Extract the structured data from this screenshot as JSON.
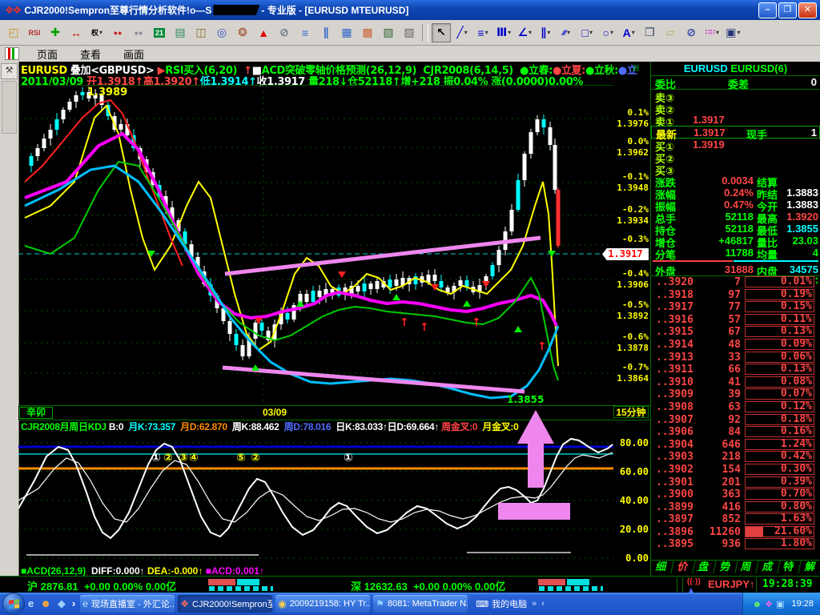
{
  "title_bar": {
    "title_left": "CJR2000!Sempron至尊行情分析软件!o—S",
    "title_right": " - 专业版 - [EURUSD MTEURUSD]",
    "minimize": "–",
    "maximize": "❐",
    "close": "✕"
  },
  "menu": {
    "items": [
      "页面",
      "查看",
      "画面"
    ]
  },
  "toolbar": {
    "left": [
      {
        "name": "open-chart-icon",
        "glyph": "◰",
        "color": "#c8901c"
      },
      {
        "name": "rsi-icon",
        "glyph": "RSI",
        "color": "#b03030",
        "small": true
      },
      {
        "name": "move-icon",
        "glyph": "✚",
        "color": "#00a000"
      },
      {
        "name": "swap-icon",
        "glyph": "↔",
        "color": "#cc0000"
      },
      {
        "name": "rights-restore-icon",
        "glyph": "权",
        "color": "#000000",
        "small": true,
        "dd": true
      },
      {
        "name": "signal-lights-icon",
        "glyph": "●●",
        "color": "#cc2222",
        "small": true
      },
      {
        "name": "signal-lights-off-icon",
        "glyph": "●●",
        "color": "#888899",
        "small": true
      },
      {
        "name": "calendar-icon",
        "glyph": "21",
        "color": "#ffffff",
        "bg": "#0a8a3a",
        "small": true
      },
      {
        "name": "books-icon",
        "glyph": "▤",
        "color": "#2e8b57"
      },
      {
        "name": "open-book-icon",
        "glyph": "◫",
        "color": "#8a6a2a"
      },
      {
        "name": "magnifier-icon",
        "glyph": "◎",
        "color": "#2a52be"
      },
      {
        "name": "palette-icon",
        "glyph": "❂",
        "color": "#a0522d"
      },
      {
        "name": "alarm-bell-icon",
        "glyph": "▲",
        "color": "#dd0000"
      },
      {
        "name": "mouse-icon",
        "glyph": "⊘",
        "color": "#667788"
      },
      {
        "name": "tile-rows-icon",
        "glyph": "≡",
        "color": "#3366cc"
      },
      {
        "name": "tile-columns-icon",
        "glyph": "∥",
        "color": "#3366cc"
      },
      {
        "name": "chart-window-icon-1",
        "glyph": "▦",
        "color": "#3366cc"
      },
      {
        "name": "chart-window-icon-2",
        "glyph": "▩",
        "color": "#cc6633"
      },
      {
        "name": "chart-window-icon-3",
        "glyph": "▨",
        "color": "#336633"
      },
      {
        "name": "chart-window-icon-4",
        "glyph": "▧",
        "color": "#666666"
      }
    ],
    "right": [
      {
        "name": "pointer-tool-icon",
        "glyph": "↖",
        "color": "#000000",
        "pressed": true
      },
      {
        "name": "line-tool-icon",
        "glyph": "╱",
        "color": "#0000cc",
        "dd": true
      },
      {
        "name": "trendline-tool-icon",
        "glyph": "≡",
        "color": "#0000cc",
        "dd": true
      },
      {
        "name": "vertline-tool-icon",
        "glyph": "Ⅲ",
        "color": "#0000cc",
        "dd": true
      },
      {
        "name": "fan-tool-icon",
        "glyph": "∠",
        "color": "#0000cc",
        "dd": true
      },
      {
        "name": "channel-tool-icon",
        "glyph": "∥",
        "color": "#0000cc",
        "dd": true
      },
      {
        "name": "hatch-tool-icon",
        "glyph": "⁄⁄⁄",
        "color": "#0000cc",
        "dd": true,
        "small": true
      },
      {
        "name": "rect-tool-icon",
        "glyph": "□",
        "color": "#0000cc",
        "dd": true
      },
      {
        "name": "circle-tool-icon",
        "glyph": "○",
        "color": "#0000cc",
        "dd": true
      },
      {
        "name": "text-tool-icon",
        "glyph": "A",
        "color": "#0000cc",
        "dd": true
      },
      {
        "name": "copy-icon",
        "glyph": "❐",
        "color": "#334466"
      },
      {
        "name": "eraser-icon",
        "glyph": "▱",
        "color": "#b8a060"
      },
      {
        "name": "lock-icon",
        "glyph": "⊘",
        "color": "#3344aa"
      },
      {
        "name": "colors-icon",
        "glyph": "∷∷",
        "color": "#cc33cc",
        "small": true,
        "dd": true
      },
      {
        "name": "save-icon",
        "glyph": "▣",
        "color": "#223377",
        "dd": true
      }
    ]
  },
  "info_line1": [
    {
      "t": "EURUSD ",
      "c": "y"
    },
    {
      "t": "叠加<GBPUSD> ",
      "c": "w"
    },
    {
      "t": "▶",
      "c": "r"
    },
    {
      "t": "RSI买入(6,20)  ",
      "c": "g"
    },
    {
      "t": "↑",
      "c": "r"
    },
    {
      "t": "■",
      "c": "w"
    },
    {
      "t": "ACD突破零轴价格预测(26,12,9)  ",
      "c": "g"
    },
    {
      "t": "CJR2008(6,14,5)  ",
      "c": "g"
    },
    {
      "t": "●",
      "c": "g"
    },
    {
      "t": "立春:",
      "c": "g"
    },
    {
      "t": "●",
      "c": "r"
    },
    {
      "t": "立夏:",
      "c": "r"
    },
    {
      "t": "●",
      "c": "g"
    },
    {
      "t": "立秋:",
      "c": "g"
    },
    {
      "t": "●",
      "c": "b"
    },
    {
      "t": "立",
      "c": "b"
    }
  ],
  "info_line2": [
    {
      "t": "2011/03/09 ",
      "c": "g"
    },
    {
      "t": "开1.3918↑",
      "c": "r"
    },
    {
      "t": "高1.3920↑",
      "c": "r"
    },
    {
      "t": "低1.3914↑",
      "c": "c"
    },
    {
      "t": "收1.3917 ",
      "c": "w"
    },
    {
      "t": "量218↓",
      "c": "g"
    },
    {
      "t": "仓52118↑",
      "c": "g"
    },
    {
      "t": "增+218 ",
      "c": "g"
    },
    {
      "t": "振0.04% ",
      "c": "g"
    },
    {
      "t": "涨(0.0000)0.00%",
      "c": "g"
    }
  ],
  "chart": {
    "axis": [
      {
        "pct": "0.1%",
        "price": "1.3976"
      },
      {
        "pct": "0.0%",
        "price": "1.3962"
      },
      {
        "pct": "-0.1%",
        "price": "1.3948"
      },
      {
        "pct": "-0.2%",
        "price": "1.3934"
      },
      {
        "pct": "-0.3%",
        "price": ""
      },
      {
        "pct": "-0.4%",
        "price": "1.3906"
      },
      {
        "pct": "-0.5%",
        "price": "1.3892"
      },
      {
        "pct": "-0.6%",
        "price": "1.3878"
      },
      {
        "pct": "-0.7%",
        "price": "1.3864"
      }
    ],
    "current_price_tag": "1.3917",
    "peak_label": "1.3989",
    "low_label": "1.3855",
    "ganzhi_label": "辛卯",
    "date_label": "03/09",
    "period_label": "15分钟"
  },
  "kdj": {
    "header": [
      {
        "t": "CJR2008月周日KDJ ",
        "c": "g"
      },
      {
        "t": "B:0  ",
        "c": "w"
      },
      {
        "t": "月K:73.357  ",
        "c": "c"
      },
      {
        "t": "月D:62.870  ",
        "c": "o"
      },
      {
        "t": "周K:88.462  ",
        "c": "w"
      },
      {
        "t": "周D:78.016  ",
        "c": "b"
      },
      {
        "t": "日K:83.033↑",
        "c": "w"
      },
      {
        "t": "日D:69.664↑ ",
        "c": "w"
      },
      {
        "t": "周金叉:0  ",
        "c": "r"
      },
      {
        "t": "月金叉:0",
        "c": "y"
      }
    ],
    "axis": [
      "80.00",
      "60.00",
      "40.00",
      "20.00",
      "0.00"
    ],
    "circles": [
      {
        "g": "①",
        "c": "w"
      },
      {
        "g": "②",
        "c": "y"
      },
      {
        "g": "③",
        "c": "y"
      },
      {
        "g": "④",
        "c": "y"
      },
      {
        "g": "⑤",
        "c": "y"
      },
      {
        "g": "②",
        "c": "y"
      },
      {
        "g": "①",
        "c": "w"
      }
    ]
  },
  "acd_line": [
    {
      "t": "■",
      "c": "g"
    },
    {
      "t": "ACD(26,12,9)  ",
      "c": "g"
    },
    {
      "t": "DIFF:0.000↑ ",
      "c": "w"
    },
    {
      "t": "DEA:-0.000↑ ",
      "c": "y"
    },
    {
      "t": "■",
      "c": "m"
    },
    {
      "t": "ACD:0.001↑",
      "c": "m"
    }
  ],
  "right_panel": {
    "symbol": "EURUSD",
    "symbol2": "EURUSD(6)",
    "weibi_label": "委比",
    "weicha_label": "委差",
    "weicha_value": "0",
    "quote_rows": [
      {
        "label": "卖③",
        "value": ""
      },
      {
        "label": "卖②",
        "value": ""
      },
      {
        "label": "卖①",
        "value": "1.3917"
      },
      {
        "label": "最新",
        "value": "1.3917",
        "label2": "现手",
        "value2": "1",
        "latest": true
      },
      {
        "label": "买①",
        "value": "1.3919"
      },
      {
        "label": "买②",
        "value": ""
      },
      {
        "label": "买③",
        "value": ""
      }
    ],
    "stat_rows": [
      {
        "l": "涨跌",
        "v": "0.0034",
        "vc": "r",
        "l2": "结算",
        "v2": "",
        "v2c": "w"
      },
      {
        "l": "涨幅",
        "v": "0.24%",
        "vc": "r",
        "l2": "昨结",
        "v2": "1.3883",
        "v2c": "w"
      },
      {
        "l": "振幅",
        "v": "0.47%",
        "vc": "r",
        "l2": "今开",
        "v2": "1.3883",
        "v2c": "w"
      },
      {
        "l": "总手",
        "v": "52118",
        "vc": "g",
        "l2": "最高",
        "v2": "1.3920",
        "v2c": "r"
      },
      {
        "l": "持仓",
        "v": "52118",
        "vc": "g",
        "l2": "最低",
        "v2": "1.3855",
        "v2c": "c"
      },
      {
        "l": "增仓",
        "v": "+46817",
        "vc": "g",
        "l2": "量比",
        "v2": "23.03",
        "v2c": "g"
      },
      {
        "l": "分笔",
        "v": "11788",
        "vc": "g",
        "l2": "均量",
        "v2": "4",
        "v2c": "g"
      },
      {
        "l": "外盘",
        "v": "31888",
        "vc": "r",
        "l2": "内盘",
        "v2": "34575",
        "v2c": "c"
      }
    ],
    "ladder": [
      {
        "p": "..3920",
        "v": "7",
        "pct": "0.01%"
      },
      {
        "p": "..3918",
        "v": "97",
        "pct": "0.19%"
      },
      {
        "p": "..3917",
        "v": "77",
        "pct": "0.15%"
      },
      {
        "p": "..3916",
        "v": "57",
        "pct": "0.11%"
      },
      {
        "p": "..3915",
        "v": "67",
        "pct": "0.13%"
      },
      {
        "p": "..3914",
        "v": "48",
        "pct": "0.09%"
      },
      {
        "p": "..3913",
        "v": "33",
        "pct": "0.06%"
      },
      {
        "p": "..3911",
        "v": "66",
        "pct": "0.13%"
      },
      {
        "p": "..3910",
        "v": "41",
        "pct": "0.08%"
      },
      {
        "p": "..3909",
        "v": "39",
        "pct": "0.07%"
      },
      {
        "p": "..3908",
        "v": "63",
        "pct": "0.12%"
      },
      {
        "p": "..3907",
        "v": "92",
        "pct": "0.18%"
      },
      {
        "p": "..3906",
        "v": "84",
        "pct": "0.16%"
      },
      {
        "p": "..3904",
        "v": "646",
        "pct": "1.24%"
      },
      {
        "p": "..3903",
        "v": "218",
        "pct": "0.42%"
      },
      {
        "p": "..3902",
        "v": "154",
        "pct": "0.30%"
      },
      {
        "p": "..3901",
        "v": "201",
        "pct": "0.39%"
      },
      {
        "p": "..3900",
        "v": "363",
        "pct": "0.70%"
      },
      {
        "p": "..3899",
        "v": "416",
        "pct": "0.80%"
      },
      {
        "p": "..3897",
        "v": "852",
        "pct": "1.63%"
      },
      {
        "p": "..3896",
        "v": "11260",
        "pct": "21.60%",
        "fill": 22
      },
      {
        "p": "..3895",
        "v": "936",
        "pct": "1.80%"
      }
    ],
    "tabs": [
      "细",
      "价",
      "盘",
      "势",
      "周",
      "成",
      "特",
      "解"
    ],
    "active_tab_index": 1
  },
  "bottom_strip": {
    "hu": [
      {
        "t": "沪 ",
        "c": "g"
      },
      {
        "t": "2876.81  ",
        "c": "g"
      },
      {
        "t": "+0.00 0.00% 0.00亿",
        "c": "g"
      }
    ],
    "shen": [
      {
        "t": "深 ",
        "c": "g"
      },
      {
        "t": "12632.63  ",
        "c": "g"
      },
      {
        "t": "+0.00 0.00% 0.00亿",
        "c": "g"
      }
    ],
    "pair_label": "EURJPY↑",
    "time": "19:28:39"
  },
  "taskbar": {
    "quick_launch": [
      {
        "name": "ie-quicklaunch-icon",
        "glyph": "e",
        "color": "#bfe0ff"
      },
      {
        "name": "qq-quicklaunch-icon",
        "glyph": "☻",
        "color": "#ffaa33"
      },
      {
        "name": "msn-quicklaunch-icon",
        "glyph": "◆",
        "color": "#9fd0ff"
      },
      {
        "name": "quicklaunch-more-icon",
        "glyph": "›",
        "color": "#ffffff"
      }
    ],
    "buttons": [
      {
        "icon": "e",
        "icolor": "#bfe0ff",
        "label": "现场直播室 - 外汇论...",
        "active": false
      },
      {
        "icon": "❖",
        "icolor": "#ff6a5a",
        "label": "CJR2000!Sempron至...",
        "active": true
      },
      {
        "icon": "◉",
        "icolor": "#ffd24a",
        "label": "2009219158: HY Tr...",
        "active": false
      },
      {
        "icon": "⚑",
        "icolor": "#8fd2ff",
        "label": "8081: MetaTrader N...",
        "active": false
      }
    ],
    "my_computer": "我的电脑",
    "tray_icons": [
      {
        "name": "messenger-tray-icon",
        "glyph": "☻",
        "color": "#66ee66"
      },
      {
        "name": "color-app-tray-icon",
        "glyph": "❖",
        "color": "#ee66ee"
      },
      {
        "name": "network-tray-icon",
        "glyph": "▣",
        "color": "#aaddff"
      }
    ],
    "time": "19:28"
  }
}
